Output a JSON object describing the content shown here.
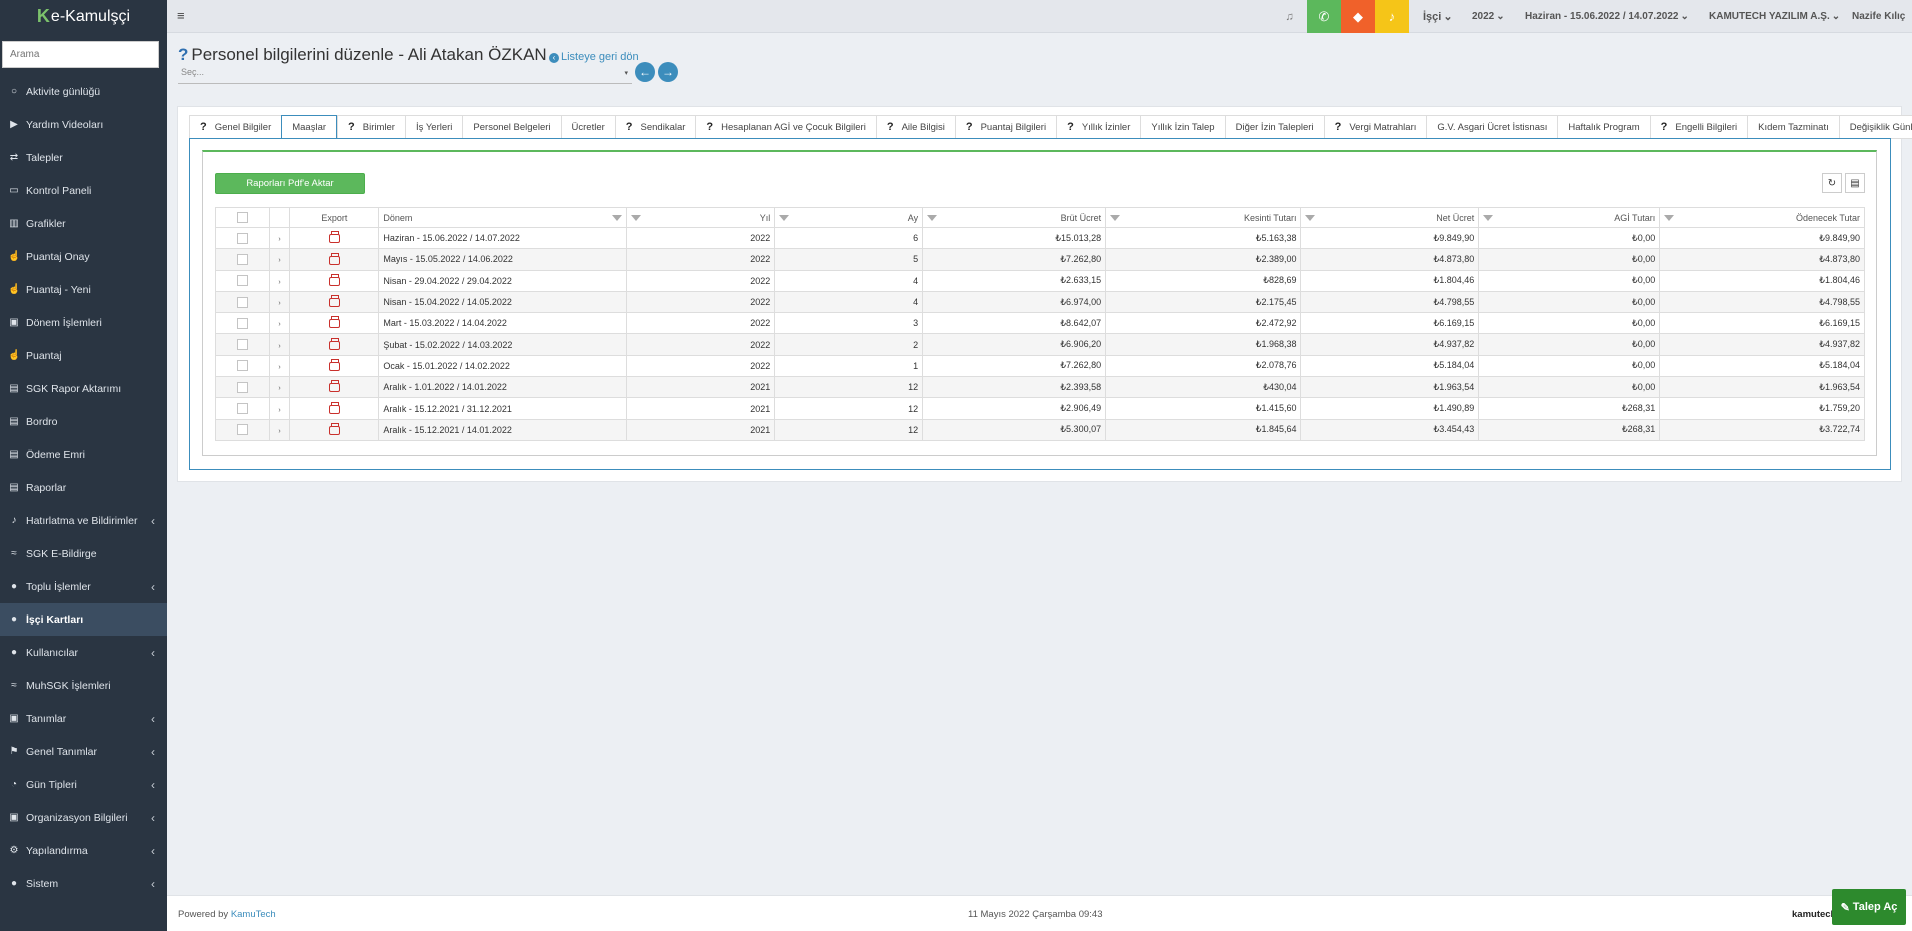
{
  "app": {
    "logo_mark": "K",
    "logo_text": "e-Kamulşçi"
  },
  "sidebar": {
    "search_placeholder": "Arama",
    "items": [
      {
        "label": "Aktivite günlüğü",
        "icon": "○",
        "chevron": ""
      },
      {
        "label": "Yardım Videoları",
        "icon": "▶",
        "chevron": ""
      },
      {
        "label": "Talepler",
        "icon": "⇄",
        "chevron": ""
      },
      {
        "label": "Kontrol Paneli",
        "icon": "▭",
        "chevron": ""
      },
      {
        "label": "Grafikler",
        "icon": "▥",
        "chevron": ""
      },
      {
        "label": "Puantaj Onay",
        "icon": "☝",
        "chevron": ""
      },
      {
        "label": "Puantaj - Yeni",
        "icon": "☝",
        "chevron": ""
      },
      {
        "label": "Dönem İşlemleri",
        "icon": "▣",
        "chevron": ""
      },
      {
        "label": "Puantaj",
        "icon": "☝",
        "chevron": ""
      },
      {
        "label": "SGK Rapor Aktarımı",
        "icon": "▤",
        "chevron": ""
      },
      {
        "label": "Bordro",
        "icon": "▤",
        "chevron": ""
      },
      {
        "label": "Ödeme Emri",
        "icon": "▤",
        "chevron": ""
      },
      {
        "label": "Raporlar",
        "icon": "▤",
        "chevron": ""
      },
      {
        "label": "Hatırlatma ve Bildirimler",
        "icon": "♪",
        "chevron": "‹"
      },
      {
        "label": "SGK E-Bildirge",
        "icon": "≈",
        "chevron": ""
      },
      {
        "label": "Toplu İşlemler",
        "icon": "●",
        "chevron": "‹"
      },
      {
        "label": "İşçi Kartları",
        "icon": "●",
        "chevron": "",
        "active": true
      },
      {
        "label": "Kullanıcılar",
        "icon": "●",
        "chevron": "‹"
      },
      {
        "label": "MuhSGK İşlemleri",
        "icon": "≈",
        "chevron": ""
      },
      {
        "label": "Tanımlar",
        "icon": "▣",
        "chevron": "‹"
      },
      {
        "label": "Genel Tanımlar",
        "icon": "⚑",
        "chevron": "‹"
      },
      {
        "label": "Gün Tipleri",
        "icon": "◔",
        "chevron": "‹"
      },
      {
        "label": "Organizasyon Bilgileri",
        "icon": "▣",
        "chevron": "‹"
      },
      {
        "label": "Yapılandırma",
        "icon": "⚙",
        "chevron": "‹"
      },
      {
        "label": "Sistem",
        "icon": "●",
        "chevron": "‹"
      }
    ]
  },
  "topbar": {
    "menu_icon": "≡",
    "bell_icon": "♫",
    "phone_icon": "✆",
    "tag_icon": "◆",
    "alert_icon": "♪",
    "role": "İşçi",
    "year": "2022",
    "period": "Haziran - 15.06.2022 / 14.07.2022",
    "company": "KAMUTECH YAZILIM A.Ş.",
    "user": "Nazife Kılıç",
    "caret": "⌄",
    "colors": {
      "phone": "#5cb85c",
      "tag": "#f0612a",
      "alert": "#f5c518"
    }
  },
  "page": {
    "help": "?",
    "title": "Personel bilgilerini düzenle - Ali Atakan ÖZKAN",
    "back_label": "Listeye geri dön",
    "back_icon": "‹",
    "select_placeholder": "Seç...",
    "select_caret": "▾",
    "prev_icon": "←",
    "next_icon": "→"
  },
  "tabs": [
    {
      "label": "Genel Bilgiler",
      "help": true
    },
    {
      "label": "Maaşlar",
      "help": false,
      "active": true
    },
    {
      "label": "Birimler",
      "help": true
    },
    {
      "label": "İş Yerleri",
      "help": false
    },
    {
      "label": "Personel Belgeleri",
      "help": false
    },
    {
      "label": "Ücretler",
      "help": false
    },
    {
      "label": "Sendikalar",
      "help": true
    },
    {
      "label": "Hesaplanan AGİ ve Çocuk Bilgileri",
      "help": true
    },
    {
      "label": "Aile Bilgisi",
      "help": true
    },
    {
      "label": "Puantaj Bilgileri",
      "help": true
    },
    {
      "label": "Yıllık İzinler",
      "help": true
    },
    {
      "label": "Yıllık İzin Talep",
      "help": false
    },
    {
      "label": "Diğer İzin Talepleri",
      "help": false
    },
    {
      "label": "Vergi Matrahları",
      "help": true
    },
    {
      "label": "G.V. Asgari Ücret İstisnası",
      "help": false
    },
    {
      "label": "Haftalık Program",
      "help": false
    },
    {
      "label": "Engelli Bilgileri",
      "help": true
    },
    {
      "label": "Kıdem Tazminatı",
      "help": false
    },
    {
      "label": "Değişiklik Günlüğü",
      "help": false
    }
  ],
  "grid": {
    "export_button": "Raporları Pdf'e Aktar",
    "refresh_icon": "↻",
    "export_icon": "▤",
    "expander": "›",
    "columns": [
      "",
      "",
      "Export",
      "Dönem",
      "Yıl",
      "Ay",
      "Brüt Ücret",
      "Kesinti Tutarı",
      "Net Ücret",
      "AGİ Tutarı",
      "Ödenecek Tutar"
    ],
    "rows": [
      [
        "Haziran - 15.06.2022 / 14.07.2022",
        "2022",
        "6",
        "₺15.013,28",
        "₺5.163,38",
        "₺9.849,90",
        "₺0,00",
        "₺9.849,90"
      ],
      [
        "Mayıs - 15.05.2022 / 14.06.2022",
        "2022",
        "5",
        "₺7.262,80",
        "₺2.389,00",
        "₺4.873,80",
        "₺0,00",
        "₺4.873,80"
      ],
      [
        "Nisan - 29.04.2022 / 29.04.2022",
        "2022",
        "4",
        "₺2.633,15",
        "₺828,69",
        "₺1.804,46",
        "₺0,00",
        "₺1.804,46"
      ],
      [
        "Nisan - 15.04.2022 / 14.05.2022",
        "2022",
        "4",
        "₺6.974,00",
        "₺2.175,45",
        "₺4.798,55",
        "₺0,00",
        "₺4.798,55"
      ],
      [
        "Mart - 15.03.2022 / 14.04.2022",
        "2022",
        "3",
        "₺8.642,07",
        "₺2.472,92",
        "₺6.169,15",
        "₺0,00",
        "₺6.169,15"
      ],
      [
        "Şubat - 15.02.2022 / 14.03.2022",
        "2022",
        "2",
        "₺6.906,20",
        "₺1.968,38",
        "₺4.937,82",
        "₺0,00",
        "₺4.937,82"
      ],
      [
        "Ocak - 15.01.2022 / 14.02.2022",
        "2022",
        "1",
        "₺7.262,80",
        "₺2.078,76",
        "₺5.184,04",
        "₺0,00",
        "₺5.184,04"
      ],
      [
        "Aralık - 1.01.2022 / 14.01.2022",
        "2021",
        "12",
        "₺2.393,58",
        "₺430,04",
        "₺1.963,54",
        "₺0,00",
        "₺1.963,54"
      ],
      [
        "Aralık - 15.12.2021 / 31.12.2021",
        "2021",
        "12",
        "₺2.906,49",
        "₺1.415,60",
        "₺1.490,89",
        "₺268,31",
        "₺1.759,20"
      ],
      [
        "Aralık - 15.12.2021 / 14.01.2022",
        "2021",
        "12",
        "₺5.300,07",
        "₺1.845,64",
        "₺3.454,43",
        "₺268,31",
        "₺3.722,74"
      ]
    ]
  },
  "footer": {
    "powered_prefix": "Powered by ",
    "powered_link": "KamuTech",
    "datetime": "11 Mayıs 2022 Çarşamba 09:43",
    "brand": "kamutech",
    "talep_label": "Talep Aç",
    "talep_icon": "✎"
  }
}
